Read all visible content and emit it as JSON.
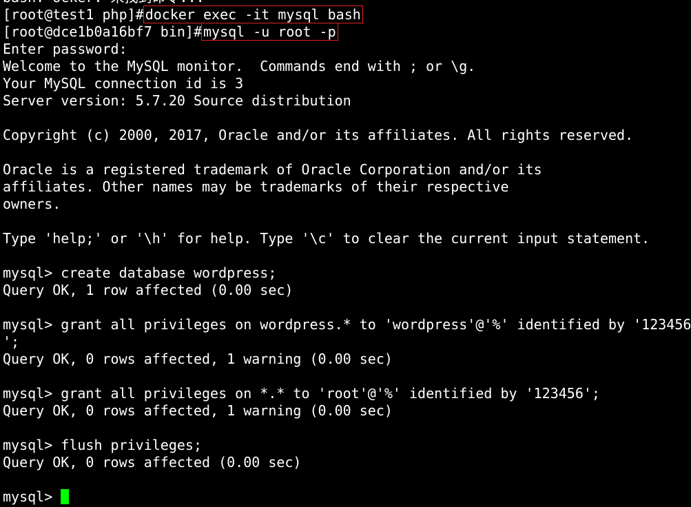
{
  "terminal": {
    "lines": [
      {
        "text": "bash: ocker: 未找到命令..."
      },
      {
        "prompt": "[root@test1 php]#",
        "command": "docker exec -it mysql bash",
        "highlighted": true
      },
      {
        "prompt": "[root@dce1b0a16bf7 bin]#",
        "command": "mysql -u root -p",
        "highlighted": true
      },
      {
        "text": "Enter password:"
      },
      {
        "text": "Welcome to the MySQL monitor.  Commands end with ; or \\g."
      },
      {
        "text": "Your MySQL connection id is 3"
      },
      {
        "text": "Server version: 5.7.20 Source distribution"
      },
      {
        "text": ""
      },
      {
        "text": "Copyright (c) 2000, 2017, Oracle and/or its affiliates. All rights reserved."
      },
      {
        "text": ""
      },
      {
        "text": "Oracle is a registered trademark of Oracle Corporation and/or its"
      },
      {
        "text": "affiliates. Other names may be trademarks of their respective"
      },
      {
        "text": "owners."
      },
      {
        "text": ""
      },
      {
        "text": "Type 'help;' or '\\h' for help. Type '\\c' to clear the current input statement."
      },
      {
        "text": ""
      },
      {
        "text": "mysql> create database wordpress;"
      },
      {
        "text": "Query OK, 1 row affected (0.00 sec)"
      },
      {
        "text": ""
      },
      {
        "text": "mysql> grant all privileges on wordpress.* to 'wordpress'@'%' identified by '123456"
      },
      {
        "text": "';"
      },
      {
        "text": "Query OK, 0 rows affected, 1 warning (0.00 sec)"
      },
      {
        "text": ""
      },
      {
        "text": "mysql> grant all privileges on *.* to 'root'@'%' identified by '123456';"
      },
      {
        "text": "Query OK, 0 rows affected, 1 warning (0.00 sec)"
      },
      {
        "text": ""
      },
      {
        "text": "mysql> flush privileges;"
      },
      {
        "text": "Query OK, 0 rows affected (0.00 sec)"
      },
      {
        "text": ""
      }
    ],
    "final_prompt": "mysql> ",
    "colors": {
      "background": "#000000",
      "text": "#ffffff",
      "highlight_box": "#e02424",
      "cursor": "#00ff00"
    }
  }
}
